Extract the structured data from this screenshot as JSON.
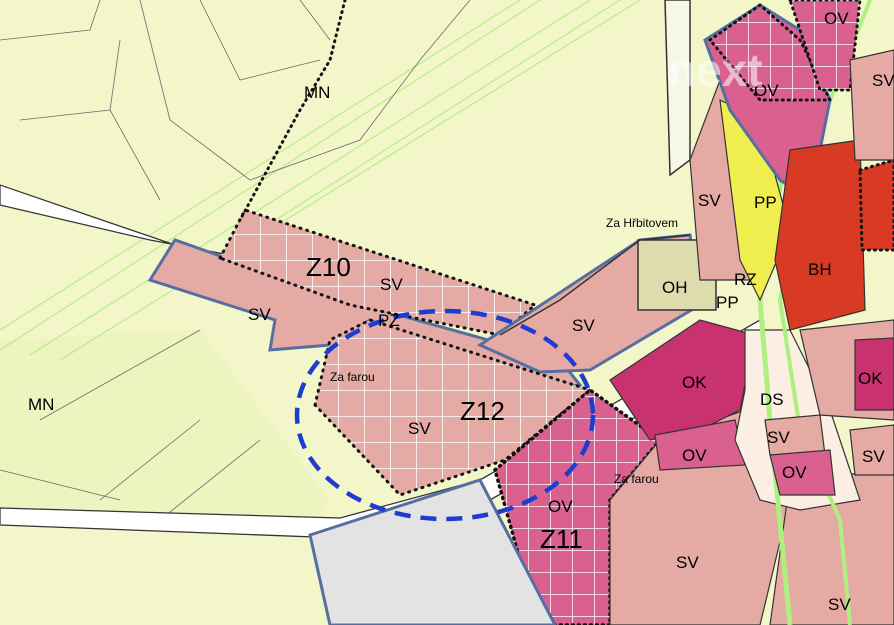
{
  "map": {
    "zone_labels": [
      "OV",
      "OV",
      "SV",
      "SV",
      "PP",
      "Z10",
      "SV",
      "SV",
      "OH",
      "PP",
      "RZ",
      "BH",
      "SV",
      "PZ",
      "OK",
      "OK",
      "DS",
      "SV",
      "OV",
      "SV",
      "Z12",
      "OV",
      "OV",
      "SV",
      "MN",
      "MN",
      "SV",
      "Z11",
      "SV"
    ],
    "street_names": [
      "Za Hřbitovem",
      "Za farou",
      "Za farou"
    ],
    "watermark": "next",
    "colors": {
      "background": "#f3f6c9",
      "residential_sv": "#e5aaa3",
      "civic_ov": "#d9608f",
      "commercial_ok": "#c8336f",
      "housing_bh": "#d83a24",
      "public_pp": "#f0ee4e",
      "greenery_oh": "#dedcad",
      "road_ds": "#fbeee3",
      "unzoned": "#e3e3e3",
      "outline_blue": "#5570a0",
      "greenway": "#aef080",
      "highlight_circle": "#1e3ccf"
    }
  }
}
